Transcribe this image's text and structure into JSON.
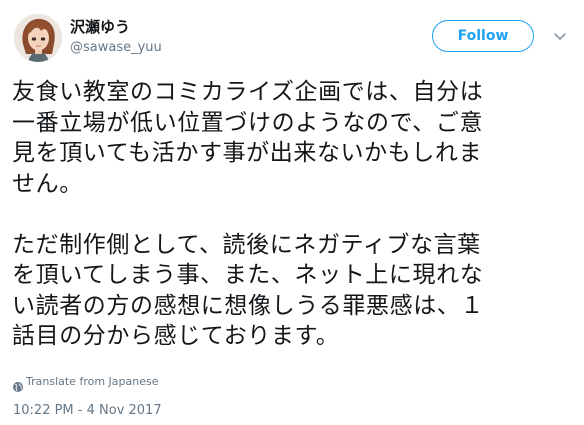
{
  "user": {
    "display_name": "沢瀬ゆう",
    "screen_name": "@sawase_yuu",
    "avatar_icon": "avatar-portrait"
  },
  "actions": {
    "follow_label": "Follow",
    "more_icon": "chevron-down-icon"
  },
  "tweet": {
    "text": "友食い教室のコミカライズ企画では、自分は\n一番立場が低い位置づけのようなので、ご意\n見を頂いても活かす事が出来ないかもしれま\nせん。\n\nただ制作側として、読後にネガティブな言葉\nを頂いてしまう事、また、ネット上に現れな\nい読者の方の感想に想像しうる罪悪感は、１\n話目の分から感じております。",
    "translate_label": "Translate from Japanese",
    "timestamp": "10:22 PM - 4 Nov 2017"
  },
  "colors": {
    "accent": "#1da1f2",
    "text": "#14171a",
    "muted": "#657786"
  }
}
